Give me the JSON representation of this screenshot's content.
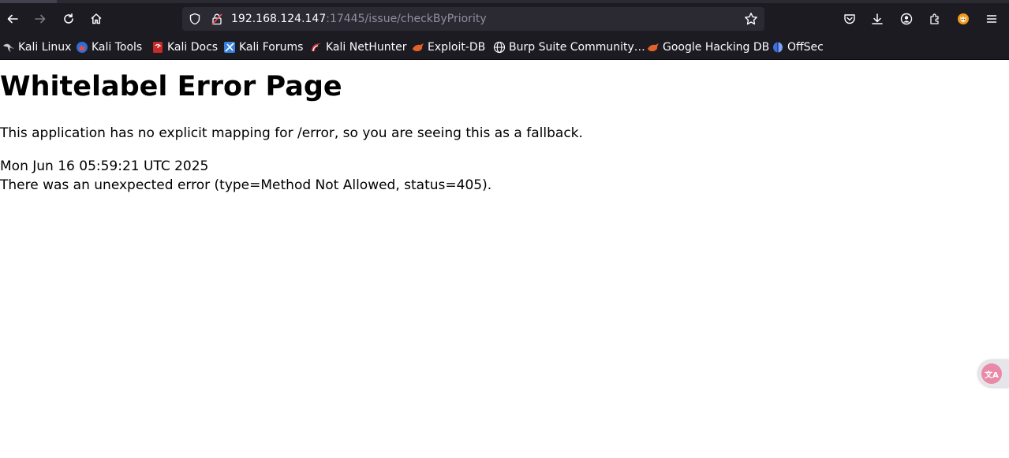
{
  "browser": {
    "url_host": "192.168.124.147",
    "url_path": ":17445/issue/checkByPriority",
    "icons": {
      "back": "back-arrow-icon",
      "forward": "forward-arrow-icon",
      "reload": "reload-icon",
      "home": "home-icon",
      "shield": "shield-icon",
      "lock": "insecure-lock-icon",
      "bookmark_star": "star-icon",
      "pocket": "pocket-icon",
      "downloads": "download-icon",
      "account": "account-icon",
      "extensions": "extensions-icon",
      "firefox_extension": "fox-extension-icon",
      "menu": "hamburger-menu-icon"
    },
    "colors": {
      "toolbar": "#1c1b22",
      "urlbar": "#2b2a33",
      "text": "#fbfbfe",
      "url_path": "#8f8f9d"
    }
  },
  "bookmarks": [
    {
      "label": "Kali Linux",
      "icon": "kali-dragon-icon"
    },
    {
      "label": "Kali Tools",
      "icon": "kali-tools-icon"
    },
    {
      "label": "Kali Docs",
      "icon": "kali-docs-icon"
    },
    {
      "label": "Kali Forums",
      "icon": "kali-forums-icon"
    },
    {
      "label": "Kali NetHunter",
      "icon": "nethunter-icon"
    },
    {
      "label": "Exploit-DB",
      "icon": "exploit-db-icon"
    },
    {
      "label": "Burp Suite Community…",
      "icon": "globe-icon"
    },
    {
      "label": "Google Hacking DB",
      "icon": "ghdb-icon"
    },
    {
      "label": "OffSec",
      "icon": "offsec-icon"
    }
  ],
  "page": {
    "title": "Whitelabel Error Page",
    "message": "This application has no explicit mapping for /error, so you are seeing this as a fallback.",
    "timestamp": "Mon Jun 16 05:59:21 UTC 2025",
    "error": "There was an unexpected error (type=Method Not Allowed, status=405)."
  },
  "widget": {
    "label": "文A",
    "icon": "translate-icon"
  }
}
